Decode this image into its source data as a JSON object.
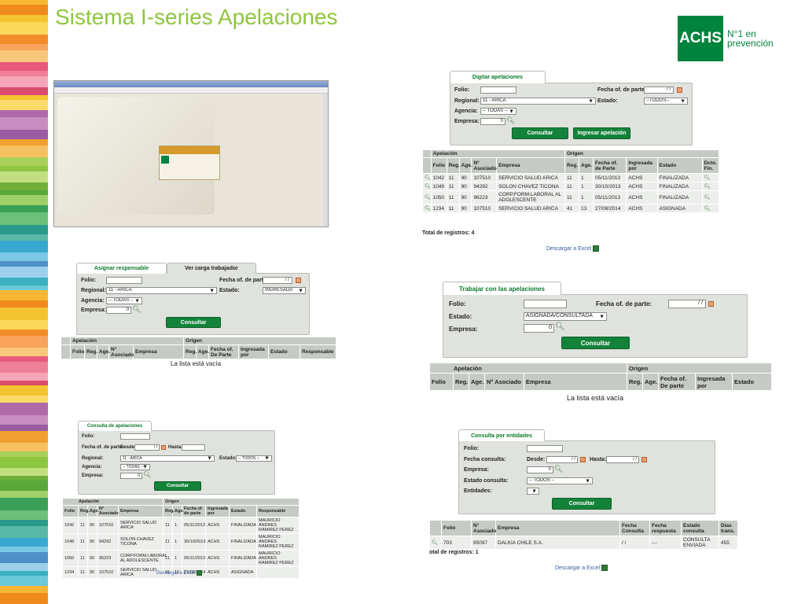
{
  "title": "Sistema I-series Apelaciones",
  "logo": {
    "mark": "ACHS",
    "tagline1": "N°1 en",
    "tagline2": "prevención"
  },
  "colors": {
    "accent": "#8dc63f",
    "brand": "#00843d",
    "button": "#14833a",
    "form_bg": "#dfe2dd",
    "header_bg": "#c6cac4"
  },
  "screens": {
    "digitar": {
      "tab": "Digitar apelaciones",
      "folio_label": "Folio:",
      "fecha_label": "Fecha of. de parte:",
      "fecha_value": "/ /",
      "regional_label": "Regional:",
      "regional_value": "11 - ARICA",
      "estado_label": "Estado:",
      "estado_value": "--TODOS--",
      "agencia_label": "Agencia:",
      "agencia_value": "-- TODAS --",
      "empresa_label": "Empresa:",
      "empresa_value": "0",
      "consultar": "Consultar",
      "ingresar": "Ingresar apelación",
      "group_apelacion": "Apelación",
      "group_origen": "Origen",
      "headers": [
        "Folio",
        "Reg.",
        "Age.",
        "N° Asociado",
        "Empresa",
        "Reg.",
        "Age.",
        "Fecha of. de Parte",
        "Ingresada por",
        "Estado",
        "Dcto. Fin."
      ],
      "rows": [
        [
          "1042",
          "11",
          "90",
          "107510",
          "SERVICIO SALUD ARICA",
          "11",
          "1",
          "05/11/2013",
          "ACHS",
          "FINALIZADA"
        ],
        [
          "1049",
          "11",
          "90",
          "94292",
          "SOLON CHAVEZ TICONA",
          "11",
          "1",
          "30/10/2013",
          "ACHS",
          "FINALIZADA"
        ],
        [
          "1050",
          "11",
          "90",
          "96223",
          "CORP.FORM.LABORAL AL ADOLESCENTE",
          "11",
          "1",
          "05/11/2013",
          "ACHS",
          "FINALIZADA"
        ],
        [
          "1234",
          "11",
          "90",
          "107510",
          "SERVICIO SALUD ARICA",
          "41",
          "13",
          "27/08/2014",
          "ACHS",
          "ASIGNADA"
        ]
      ],
      "total": "Total de registros: 4",
      "excel": "Descargar a Excel"
    },
    "asignar": {
      "tab1": "Asignar responsable",
      "tab2": "Ver carga trabajador",
      "folio_label": "Folio:",
      "fecha_label": "Fecha of. de parte:",
      "fecha_value": "/ /",
      "regional_label": "Regional:",
      "regional_value": "11 - ARICA",
      "estado_label": "Estado:",
      "estado_value": "INGRESADA",
      "agencia_label": "Agencia:",
      "agencia_value": "-- TODAS --",
      "empresa_label": "Empresa:",
      "empresa_value": "0",
      "consultar": "Consultar",
      "group_apelacion": "Apelación",
      "group_origen": "Origen",
      "headers": [
        "Folio",
        "Reg.",
        "Age.",
        "N° Asociado",
        "Empresa",
        "Reg.",
        "Age.",
        "Fecha of. De Parte",
        "Ingresada por",
        "Estado",
        "Responsable"
      ],
      "empty": "La lista está vacía"
    },
    "trabajar": {
      "tab": "Trabajar con las apelaciones",
      "folio_label": "Folio:",
      "fecha_label": "Fecha of. de parte:",
      "fecha_value": "/ /",
      "estado_label": "Estado:",
      "estado_value": "ASIGNADA/CONSULTADA",
      "empresa_label": "Empresa:",
      "empresa_value": "0",
      "consultar": "Consultar",
      "group_apelacion": "Apelación",
      "group_origen": "Origen",
      "headers": [
        "Folio",
        "Reg.",
        "Age.",
        "N° Asociado",
        "Empresa",
        "Reg.",
        "Age.",
        "Fecha of. De parte",
        "Ingresada por",
        "Estado"
      ],
      "empty": "La lista está vacía"
    },
    "consulta": {
      "tab": "Consulta de apelaciones",
      "folio_label": "Folio:",
      "fecha_label": "Fecha of. de parte:",
      "desde_label": "Desde:",
      "desde_value": "/ /",
      "hasta_label": "Hasta:",
      "regional_label": "Regional:",
      "regional_value": "11 - ARICA",
      "estado_label": "Estado:",
      "estado_value": "-- TODOS --",
      "agencia_label": "Agencia:",
      "agencia_value": "-- TODAS --",
      "empresa_label": "Empresa:",
      "empresa_value": "0",
      "consultar": "Consultar",
      "group_apelacion": "Apelación",
      "group_origen": "Origen",
      "headers": [
        "Folio",
        "Reg.",
        "Age.",
        "N° Asociado",
        "Empresa",
        "Reg.",
        "Age.",
        "Fecha of. de parte",
        "Ingresada por",
        "Estado",
        "Responsable"
      ],
      "rows": [
        [
          "1042",
          "11",
          "90",
          "107510",
          "SERVICIO SALUD ARICA",
          "11",
          "1",
          "05/11/2013",
          "ACHS",
          "FINALIZADA",
          "MAURICIO ANDRES RAMIREZ PEREZ"
        ],
        [
          "1049",
          "11",
          "90",
          "94292",
          "SOLON CHAVEZ TICONA",
          "11",
          "1",
          "30/10/2013",
          "ACHS",
          "FINALIZADA",
          "MAURICIO ANDRES RAMIREZ PEREZ"
        ],
        [
          "1050",
          "11",
          "90",
          "96223",
          "CORP.FORM.LABORAL AL ADOLESCENTE",
          "11",
          "1",
          "05/11/2013",
          "ACHS",
          "FINALIZADA",
          "MAURICIO ANDRES RAMIREZ PEREZ"
        ],
        [
          "1234",
          "11",
          "90",
          "107510",
          "SERVICIO SALUD ARICA",
          "41",
          "13",
          "27/08/2014",
          "ACHS",
          "ASIGNADA",
          ""
        ]
      ],
      "excel": "Descargar a Excel"
    },
    "entidades": {
      "tab": "Consulta por entidades",
      "folio_label": "Folio:",
      "fecha_label": "Fecha consulta:",
      "desde_label": "Desde:",
      "desde_value": "/ /",
      "hasta_label": "Hasta:",
      "hasta_value": "/ /",
      "empresa_label": "Empresa:",
      "empresa_value": "0",
      "estado_label": "Estado consulta:",
      "estado_value": "-- TODOS --",
      "entidades_label": "Entidades:",
      "consultar": "Consultar",
      "headers": [
        "Folio",
        "N° Asociado",
        "Empresa",
        "Fecha Consulta",
        "Fecha respuesta",
        "Estado consulta",
        "Días trans."
      ],
      "rows": [
        [
          "703",
          "95097",
          "DALKIA CHILE S.A.",
          "/ /",
          "---",
          "CONSULTA ENVIADA",
          "455"
        ]
      ],
      "total": "otal de registros: 1",
      "excel": "Descargar a Excel"
    }
  }
}
